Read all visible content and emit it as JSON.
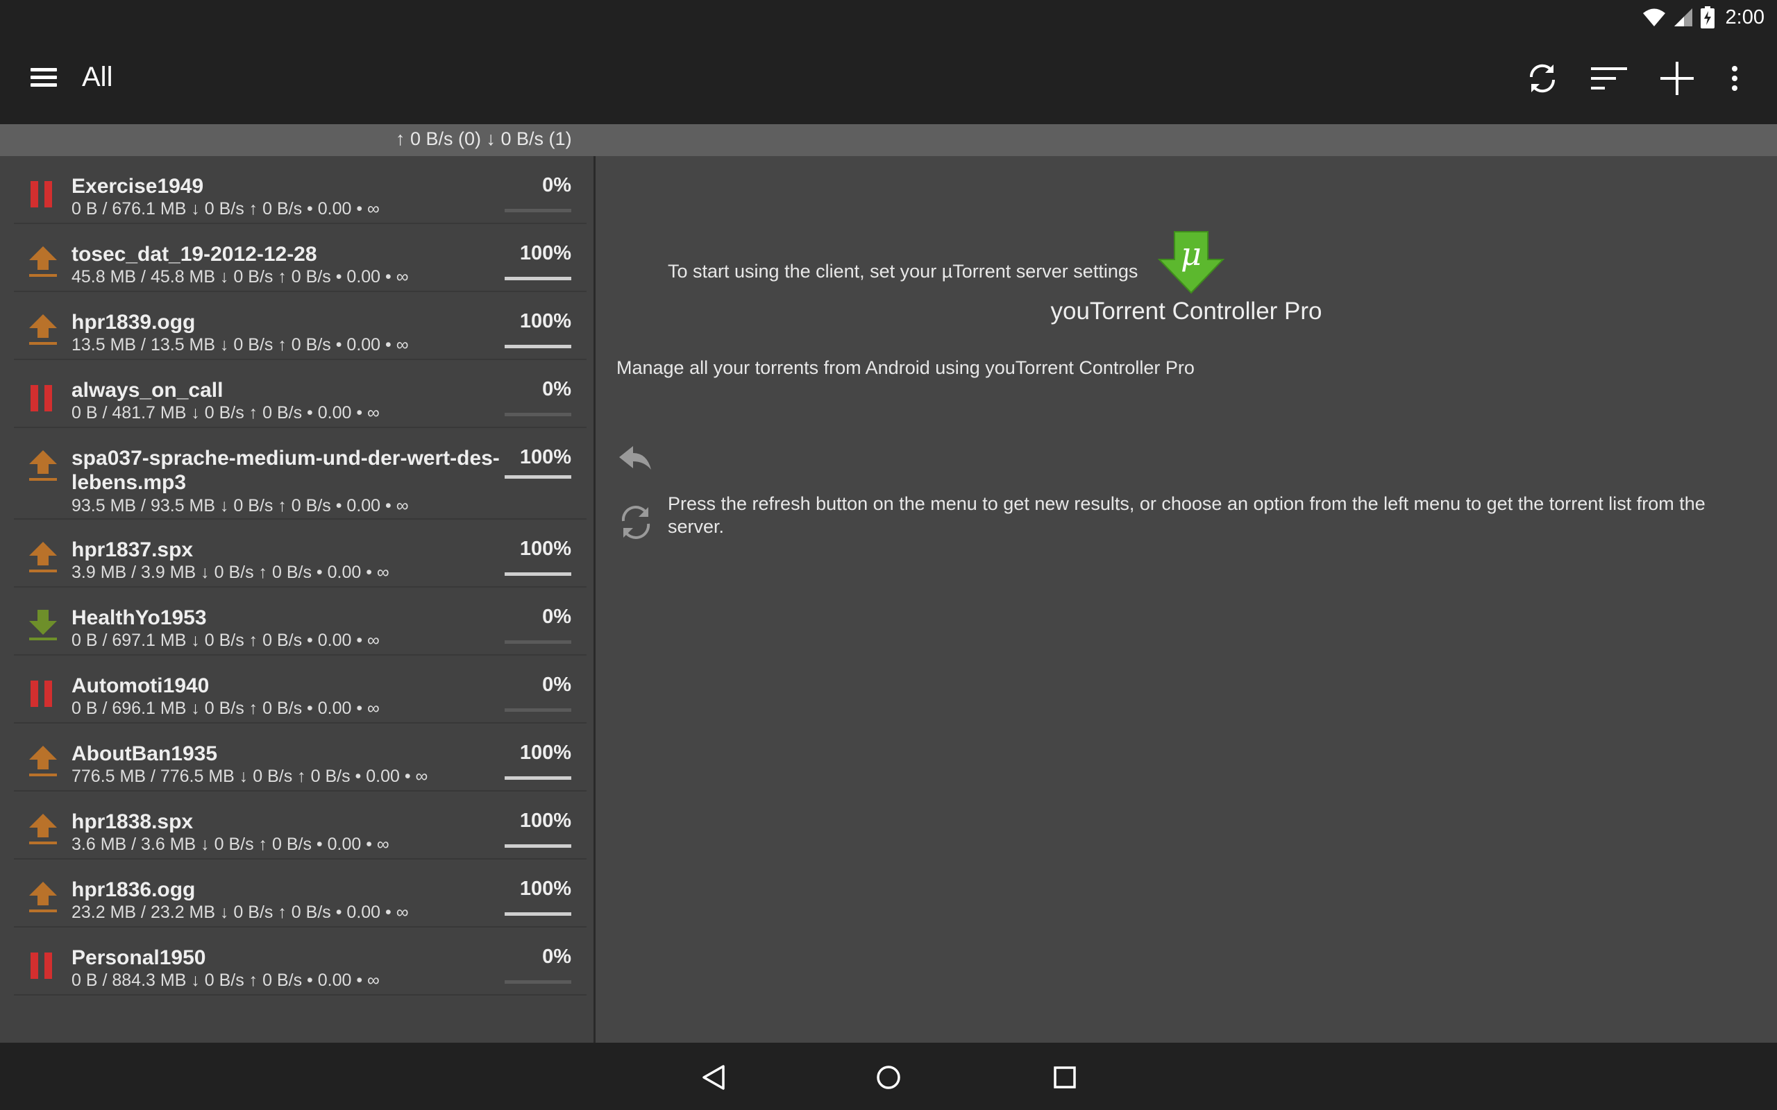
{
  "status": {
    "time": "2:00"
  },
  "appbar": {
    "title": "All",
    "actions": [
      "refresh-icon",
      "sort-icon",
      "add-icon",
      "overflow-menu-icon"
    ]
  },
  "speed": {
    "text": "↑ 0 B/s (0)  ↓ 0 B/s (1)"
  },
  "torrents": [
    {
      "name": "Exercise1949",
      "info": "0 B / 676.1 MB ↓ 0 B/s ↑ 0 B/s • 0.00 • ∞",
      "percent": "0%",
      "progress": 0,
      "state": "paused",
      "icon": "pause-icon"
    },
    {
      "name": "tosec_dat_19-2012-12-28",
      "info": "45.8 MB / 45.8 MB ↓ 0 B/s ↑ 0 B/s • 0.00 • ∞",
      "percent": "100%",
      "progress": 100,
      "state": "seeding",
      "icon": "upload-icon"
    },
    {
      "name": "hpr1839.ogg",
      "info": "13.5 MB / 13.5 MB ↓ 0 B/s ↑ 0 B/s • 0.00 • ∞",
      "percent": "100%",
      "progress": 100,
      "state": "seeding",
      "icon": "upload-icon"
    },
    {
      "name": "always_on_call",
      "info": "0 B / 481.7 MB ↓ 0 B/s ↑ 0 B/s • 0.00 • ∞",
      "percent": "0%",
      "progress": 0,
      "state": "paused",
      "icon": "pause-icon"
    },
    {
      "name": "spa037-sprache-medium-und-der-wert-des-lebens.mp3",
      "info": "93.5 MB / 93.5 MB ↓ 0 B/s ↑ 0 B/s • 0.00 • ∞",
      "percent": "100%",
      "progress": 100,
      "state": "seeding",
      "icon": "upload-icon"
    },
    {
      "name": "hpr1837.spx",
      "info": "3.9 MB / 3.9 MB ↓ 0 B/s ↑ 0 B/s • 0.00 • ∞",
      "percent": "100%",
      "progress": 100,
      "state": "seeding",
      "icon": "upload-icon"
    },
    {
      "name": "HealthYo1953",
      "info": "0 B / 697.1 MB ↓ 0 B/s ↑ 0 B/s • 0.00 • ∞",
      "percent": "0%",
      "progress": 0,
      "state": "downloading",
      "icon": "download-icon"
    },
    {
      "name": "Automoti1940",
      "info": "0 B / 696.1 MB ↓ 0 B/s ↑ 0 B/s • 0.00 • ∞",
      "percent": "0%",
      "progress": 0,
      "state": "paused",
      "icon": "pause-icon"
    },
    {
      "name": "AboutBan1935",
      "info": "776.5 MB / 776.5 MB ↓ 0 B/s ↑ 0 B/s • 0.00 • ∞",
      "percent": "100%",
      "progress": 100,
      "state": "seeding",
      "icon": "upload-icon"
    },
    {
      "name": "hpr1838.spx",
      "info": "3.6 MB / 3.6 MB ↓ 0 B/s ↑ 0 B/s • 0.00 • ∞",
      "percent": "100%",
      "progress": 100,
      "state": "seeding",
      "icon": "upload-icon"
    },
    {
      "name": "hpr1836.ogg",
      "info": "23.2 MB / 23.2 MB ↓ 0 B/s ↑ 0 B/s • 0.00 • ∞",
      "percent": "100%",
      "progress": 100,
      "state": "seeding",
      "icon": "upload-icon"
    },
    {
      "name": "Personal1950",
      "info": "0 B / 884.3 MB ↓ 0 B/s ↑ 0 B/s • 0.00 • ∞",
      "percent": "0%",
      "progress": 0,
      "state": "paused",
      "icon": "pause-icon"
    }
  ],
  "welcome": {
    "logo_glyph": "μ",
    "app_name": "youTorrent Controller Pro",
    "manage_text": "Manage all your torrents from Android using youTorrent Controller Pro",
    "hint_settings": "To start using the client, set your µTorrent server settings",
    "hint_refresh": "Press the refresh button on the menu to get new results, or choose an option from the left menu to get the torrent list from the server."
  },
  "colors": {
    "paused": "#d32f2f",
    "seeding": "#b9722a",
    "downloading": "#6e8f2a",
    "logo_green": "#5cb82e"
  }
}
